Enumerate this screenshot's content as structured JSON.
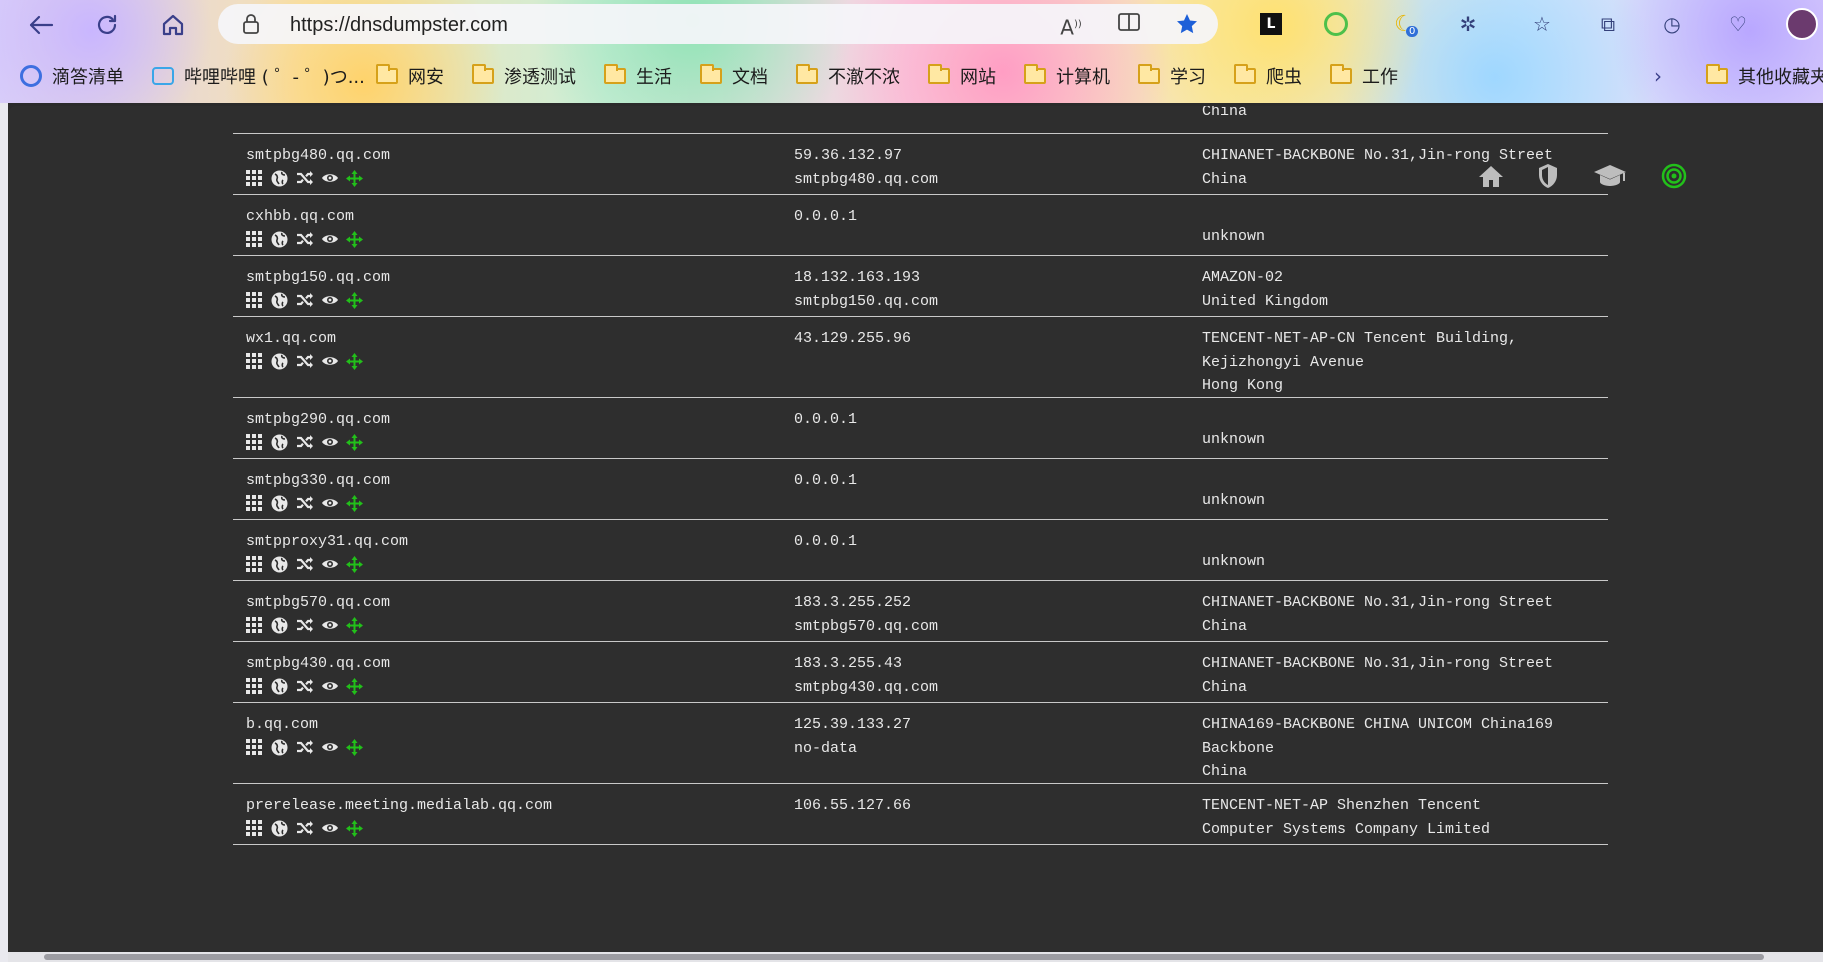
{
  "browser": {
    "url": "https://dnsdumpster.com",
    "extension_badge": "0",
    "bookmarks": [
      {
        "label": "滴答清单",
        "icon": "check-icon"
      },
      {
        "label": "哔哩哔哩 ( ゜- ゜)つ...",
        "icon": "bilibili-icon"
      },
      {
        "label": "网安",
        "icon": "folder-icon"
      },
      {
        "label": "渗透测试",
        "icon": "folder-icon"
      },
      {
        "label": "生活",
        "icon": "folder-icon"
      },
      {
        "label": "文档",
        "icon": "folder-icon"
      },
      {
        "label": "不澈不浓",
        "icon": "folder-icon"
      },
      {
        "label": "网站",
        "icon": "folder-icon"
      },
      {
        "label": "计算机",
        "icon": "folder-icon"
      },
      {
        "label": "学习",
        "icon": "folder-icon"
      },
      {
        "label": "爬虫",
        "icon": "folder-icon"
      },
      {
        "label": "工作",
        "icon": "folder-icon"
      }
    ],
    "other_bookmarks": "其他收藏夹"
  },
  "colors": {
    "page_bg": "#2e2e2e",
    "text": "#e8e8e8",
    "divider": "#c9c9c9",
    "accent_green": "#22c01a"
  },
  "header_icons": [
    "home-icon",
    "shield-icon",
    "graduation-cap-icon",
    "target-icon"
  ],
  "row_icons": [
    "grid-icon",
    "globe-icon",
    "shuffle-icon",
    "eye-icon",
    "crosshair-icon"
  ],
  "partial_top_row": {
    "col3": "China"
  },
  "rows": [
    {
      "host": "smtpbg480.qq.com",
      "ip": "59.36.132.97",
      "reverse": "smtpbg480.qq.com",
      "asn": [
        "CHINANET-BACKBONE No.31,Jin-rong Street",
        "China"
      ]
    },
    {
      "host": "cxhbb.qq.com",
      "ip": "0.0.0.1",
      "reverse": "",
      "asn": [
        "",
        "unknown"
      ]
    },
    {
      "host": "smtpbg150.qq.com",
      "ip": "18.132.163.193",
      "reverse": "smtpbg150.qq.com",
      "asn": [
        "AMAZON-02",
        "United Kingdom"
      ]
    },
    {
      "host": "wx1.qq.com",
      "ip": "43.129.255.96",
      "reverse": "",
      "asn": [
        "TENCENT-NET-AP-CN Tencent Building,",
        "Kejizhongyi Avenue",
        "Hong Kong"
      ]
    },
    {
      "host": "smtpbg290.qq.com",
      "ip": "0.0.0.1",
      "reverse": "",
      "asn": [
        "",
        "unknown"
      ]
    },
    {
      "host": "smtpbg330.qq.com",
      "ip": "0.0.0.1",
      "reverse": "",
      "asn": [
        "",
        "unknown"
      ]
    },
    {
      "host": "smtpproxy31.qq.com",
      "ip": "0.0.0.1",
      "reverse": "",
      "asn": [
        "",
        "unknown"
      ]
    },
    {
      "host": "smtpbg570.qq.com",
      "ip": "183.3.255.252",
      "reverse": "smtpbg570.qq.com",
      "asn": [
        "CHINANET-BACKBONE No.31,Jin-rong Street",
        "China"
      ]
    },
    {
      "host": "smtpbg430.qq.com",
      "ip": "183.3.255.43",
      "reverse": "smtpbg430.qq.com",
      "asn": [
        "CHINANET-BACKBONE No.31,Jin-rong Street",
        "China"
      ]
    },
    {
      "host": "b.qq.com",
      "ip": "125.39.133.27",
      "reverse": "no-data",
      "asn": [
        "CHINA169-BACKBONE CHINA UNICOM China169",
        "Backbone",
        "China"
      ]
    },
    {
      "host": "prerelease.meeting.medialab.qq.com",
      "ip": "106.55.127.66",
      "reverse": "",
      "asn": [
        "TENCENT-NET-AP Shenzhen Tencent",
        "Computer Systems Company Limited"
      ]
    }
  ]
}
